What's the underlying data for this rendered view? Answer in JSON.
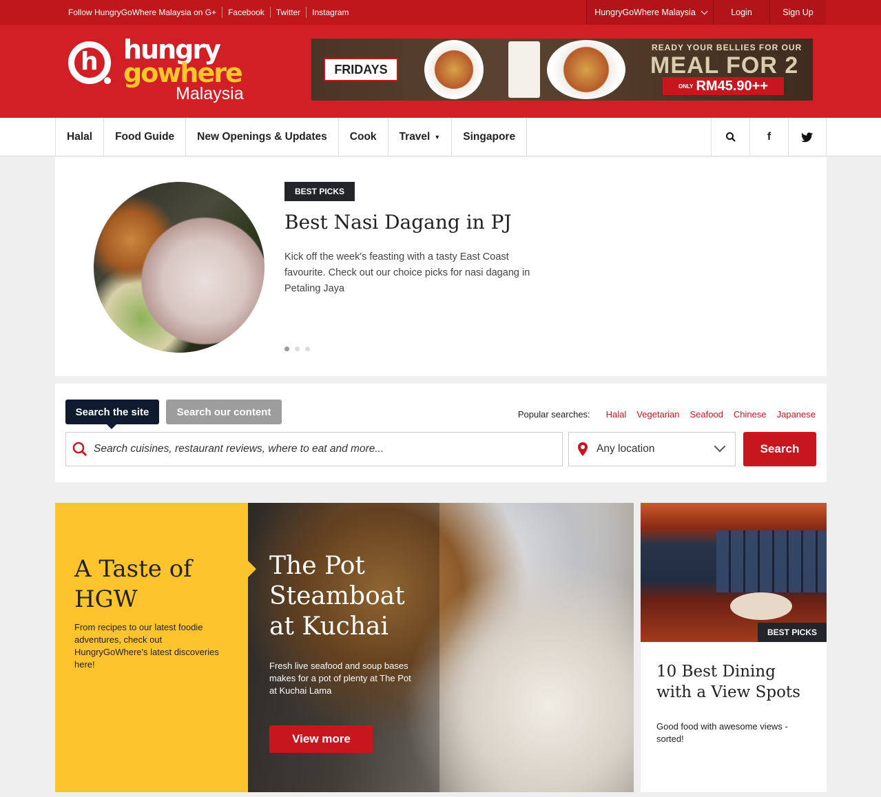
{
  "topbar": {
    "follow_gplus": "Follow HungryGoWhere Malaysia on G+",
    "facebook": "Facebook",
    "twitter": "Twitter",
    "instagram": "Instagram",
    "region": "HungryGoWhere Malaysia",
    "login": "Login",
    "signup": "Sign Up"
  },
  "logo": {
    "line1": "hungry",
    "line2": "gowhere",
    "line3": "Malaysia"
  },
  "banner": {
    "brand": "FRIDAYS",
    "tagline": "READY YOUR BELLIES FOR OUR",
    "headline": "MEAL FOR 2",
    "price_prefix": "ONLY",
    "price": "RM45.90++"
  },
  "nav": {
    "items": [
      "Halal",
      "Food Guide",
      "New Openings & Updates",
      "Cook",
      "Travel",
      "Singapore"
    ],
    "icons": [
      "search-icon",
      "facebook-icon",
      "twitter-icon"
    ]
  },
  "hero": {
    "badge": "BEST PICKS",
    "title": "Best Nasi Dagang in PJ",
    "description": "Kick off the week's feasting with a tasty East Coast favourite. Check out our choice picks for nasi dagang in Petaling Jaya",
    "slides": 3,
    "active_slide": 1
  },
  "search": {
    "tab_active": "Search the site",
    "tab_inactive": "Search our content",
    "popular_label": "Popular searches:",
    "popular": [
      "Halal",
      "Vegetarian",
      "Seafood",
      "Chinese",
      "Japanese"
    ],
    "placeholder": "Search cuisines, restaurant reviews, where to eat and more...",
    "location": "Any location",
    "button": "Search"
  },
  "features": {
    "intro_title": "A Taste of HGW",
    "intro_text": "From recipes to our latest foodie adventures, check out HungryGoWhere's latest discoveries here!",
    "main_title": "The Pot Steamboat at Kuchai",
    "main_text": "Fresh live seafood and soup bases makes for a pot of plenty at The Pot at Kuchai Lama",
    "main_button": "View more",
    "side_badge": "BEST PICKS",
    "side_title": "10 Best Dining with a View Spots",
    "side_text": "Good food with awesome views - sorted!"
  },
  "colors": {
    "brand_red": "#d21f26",
    "topbar_red": "#c0171d",
    "accent_yellow": "#fec42d",
    "dark_badge": "#23252b",
    "navy_tab": "#0e1b2e"
  }
}
